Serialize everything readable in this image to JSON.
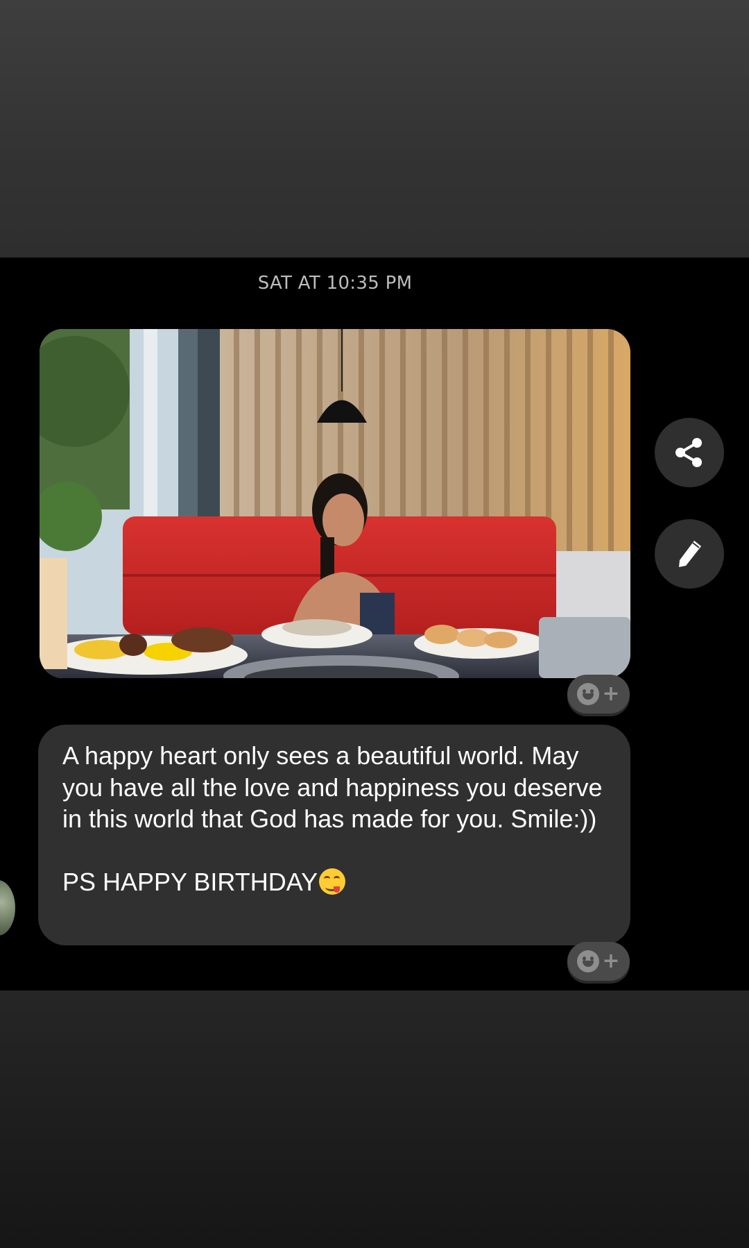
{
  "conversation": {
    "timestamp": "SAT AT 10:35 PM",
    "messages": [
      {
        "type": "photo",
        "alt": "photo-message"
      },
      {
        "type": "text",
        "text": "A happy heart only sees a beautiful world. May you have all the love and happiness you deserve in this world that God has made for you. Smile:))\n\nPS HAPPY BIRTHDAY",
        "trailing_emoji": "face-savoring-food-emoji"
      }
    ]
  },
  "side_actions": {
    "share_icon": "share-icon",
    "edit_icon": "pencil-icon"
  },
  "reaction_button": {
    "icon": "add-reaction-icon",
    "plus": "+"
  },
  "colors": {
    "background": "#000000",
    "bubble": "#303030",
    "reaction_button": "#4a4a4a",
    "side_button": "#2f2f2f",
    "timestamp_text": "#bdbdbd"
  }
}
